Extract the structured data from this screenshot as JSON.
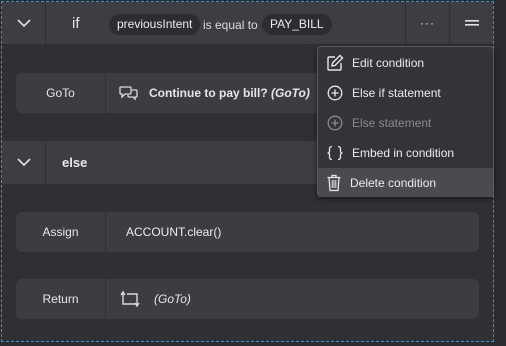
{
  "if_block": {
    "keyword": "if",
    "variable": "previousIntent",
    "operator": "is equal to",
    "value": "PAY_BILL",
    "more_label": "···"
  },
  "goto_row": {
    "label": "GoTo",
    "target": "Continue to pay bill?",
    "suffix": "(GoTo)"
  },
  "else_block": {
    "keyword": "else"
  },
  "assign_row": {
    "label": "Assign",
    "value": "ACCOUNT.clear()"
  },
  "return_row": {
    "label": "Return",
    "suffix": "(GoTo)"
  },
  "menu": {
    "items": [
      {
        "label": "Edit condition",
        "icon": "edit-icon"
      },
      {
        "label": "Else if statement",
        "icon": "plus-circle-icon"
      },
      {
        "label": "Else statement",
        "icon": "plus-circle-icon"
      },
      {
        "label": "Embed in condition",
        "icon": "braces-icon"
      },
      {
        "label": "Delete condition",
        "icon": "trash-icon"
      }
    ]
  },
  "colors": {
    "border_accent": "#3a8fd4",
    "row_bg": "#3c3d42",
    "menu_bg": "#333438"
  }
}
